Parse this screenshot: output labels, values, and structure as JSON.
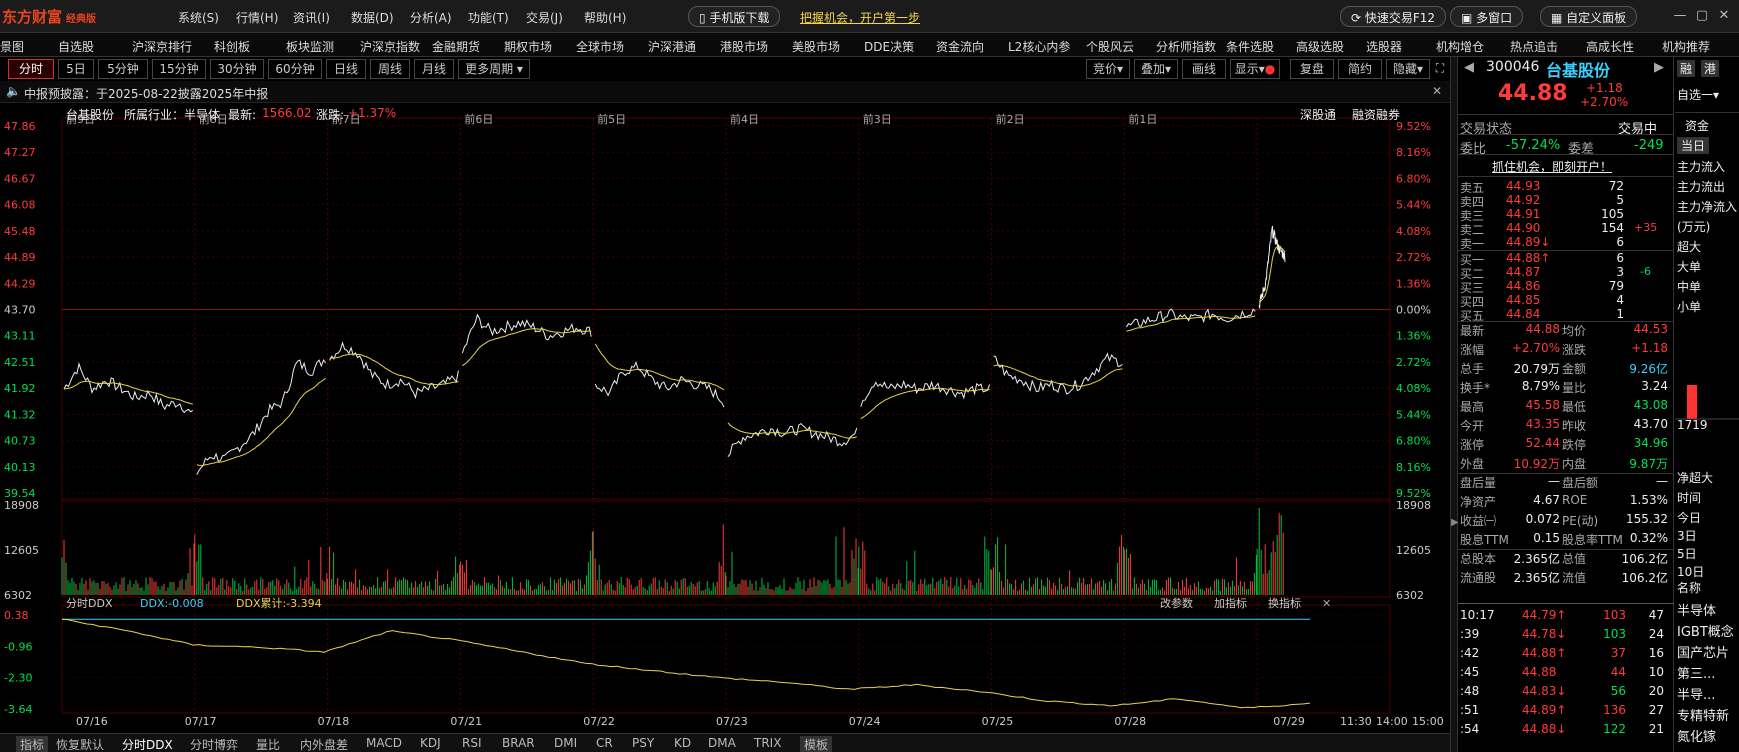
{
  "topbar": {
    "logo": "东方财富",
    "edition": "经典版",
    "menus": [
      "系统(S)",
      "行情(H)",
      "资讯(I)",
      "数据(D)",
      "分析(A)",
      "功能(T)",
      "交易(J)",
      "帮助(H)"
    ],
    "mobile_download": "手机版下载",
    "promo": "把握机会，开户第一步",
    "quick_trade": "快速交易F12",
    "multi_window": "多窗口",
    "custom_panel": "自定义面板"
  },
  "navbar": {
    "items": [
      "景图",
      "自选股",
      "沪深京排行",
      "科创板",
      "板块监测",
      "沪深京指数",
      "金融期货",
      "期权市场",
      "全球市场",
      "沪深港通",
      "港股市场",
      "美股市场",
      "DDE决策",
      "资金流向",
      "L2核心内参",
      "个股风云",
      "分析师指数",
      "条件选股",
      "高级选股",
      "选股器",
      "机构增仓",
      "热点追击",
      "高成长性",
      "机构推荐"
    ]
  },
  "period_tabs": [
    "分时",
    "5日",
    "5分钟",
    "15分钟",
    "30分钟",
    "60分钟",
    "日线",
    "周线",
    "月线",
    "更多周期"
  ],
  "right_tools": [
    "竞价",
    "叠加",
    "画线",
    "显示",
    "复盘",
    "简约",
    "隐藏"
  ],
  "notice": "中报预披露：于2025-08-22披露2025年中报",
  "stock_info": {
    "name": "台基股份",
    "industry_label": "所属行业：半导体",
    "latest_label": "最新:",
    "latest_value": "1566.02",
    "change_label": "涨跌:",
    "change_value": "+1.37%",
    "shen_gu_tong": "深股通",
    "rong_zi": "融资融券"
  },
  "chart_data": {
    "type": "line",
    "title": "",
    "ylim": [
      39.54,
      47.86
    ],
    "price_ticks_left": [
      "47.86",
      "47.27",
      "46.67",
      "46.08",
      "45.48",
      "44.89",
      "44.29",
      "43.70",
      "43.11",
      "42.51",
      "41.92",
      "41.32",
      "40.73",
      "40.13",
      "39.54"
    ],
    "pct_ticks_right": [
      "9.52%",
      "8.16%",
      "6.80%",
      "5.44%",
      "4.08%",
      "2.72%",
      "1.36%",
      "0.00%",
      "1.36%",
      "2.72%",
      "4.08%",
      "5.44%",
      "6.80%",
      "8.16%",
      "9.52%"
    ],
    "day_labels_top": [
      "前9日",
      "前8日",
      "前7日",
      "前6日",
      "前5日",
      "前4日",
      "前3日",
      "前2日",
      "前1日"
    ],
    "date_labels": [
      "07/16",
      "07/17",
      "07/18",
      "07/21",
      "07/22",
      "07/23",
      "07/24",
      "07/25",
      "07/28",
      "07/29"
    ],
    "time_labels": [
      "11:30",
      "14:00",
      "15:00"
    ],
    "prev_close": 43.7,
    "series": [
      {
        "day": "07/16",
        "open": 41.9,
        "points": [
          41.9,
          42.4,
          41.9,
          42.1,
          41.9,
          41.7,
          41.8,
          41.5,
          41.6,
          41.3
        ]
      },
      {
        "day": "07/17",
        "open": 40.2,
        "points": [
          40.0,
          40.4,
          40.3,
          40.6,
          40.9,
          41.4,
          41.6,
          42.5,
          42.3,
          42.6
        ]
      },
      {
        "day": "07/18",
        "open": 42.6,
        "points": [
          42.6,
          42.9,
          42.7,
          42.2,
          42.0,
          42.1,
          41.8,
          41.9,
          42.0,
          42.2
        ]
      },
      {
        "day": "07/21",
        "open": 42.4,
        "points": [
          42.7,
          43.5,
          43.2,
          43.3,
          43.4,
          43.3,
          43.1,
          43.2,
          43.3,
          43.2
        ]
      },
      {
        "day": "07/22",
        "open": 43.0,
        "points": [
          42.0,
          41.8,
          42.3,
          42.4,
          42.1,
          41.9,
          42.1,
          42.0,
          41.9,
          41.6
        ]
      },
      {
        "day": "07/23",
        "open": 41.2,
        "points": [
          40.4,
          40.8,
          40.9,
          41.0,
          40.9,
          41.0,
          40.9,
          40.8,
          40.7,
          40.9
        ]
      },
      {
        "day": "07/24",
        "open": 41.2,
        "points": [
          41.6,
          42.1,
          41.9,
          42.0,
          41.9,
          42.0,
          41.9,
          41.8,
          41.9,
          41.9
        ]
      },
      {
        "day": "07/25",
        "open": 42.4,
        "points": [
          42.6,
          42.2,
          42.1,
          41.9,
          42.0,
          41.9,
          42.0,
          42.3,
          42.6,
          42.5
        ]
      },
      {
        "day": "07/28",
        "open": 43.2,
        "points": [
          43.3,
          43.4,
          43.5,
          43.6,
          43.5,
          43.5,
          43.6,
          43.5,
          43.6,
          43.7
        ]
      },
      {
        "day": "07/29",
        "open": 43.9,
        "points": [
          43.8,
          44.3,
          45.5,
          45.1,
          44.9
        ]
      }
    ],
    "volume_ticks": [
      "18908",
      "12605",
      "6302"
    ],
    "ddx_panel": {
      "label": "分时DDX",
      "ddx": "DDX:-0.008",
      "ddx_sum": "DDX累计:-3.394",
      "ticks": [
        "0.38",
        "-0.96",
        "-2.30",
        "-3.64"
      ],
      "ylim": [
        -3.64,
        0.38
      ],
      "cumulative": [
        0.2,
        -0.3,
        -0.9,
        -1.0,
        -1.2,
        -0.3,
        -0.7,
        -1.2,
        -1.7,
        -2.0,
        -2.3,
        -2.5,
        -2.8,
        -2.6,
        -2.9,
        -3.3,
        -3.5,
        -3.2,
        -3.6,
        -3.4
      ],
      "buttons": [
        "改参数",
        "加指标",
        "换指标"
      ]
    }
  },
  "bottom_tabs": [
    "指标",
    "恢复默认",
    "分时DDX",
    "分时博弈",
    "量比",
    "内外盘差",
    "MACD",
    "KDJ",
    "RSI",
    "BRAR",
    "DMI",
    "CR",
    "PSY",
    "KD",
    "DMA",
    "TRIX",
    "模板"
  ],
  "quote": {
    "code": "300046",
    "name": "台基股份",
    "price": "44.88",
    "change": "+1.18",
    "change_pct": "+2.70%",
    "status_label": "交易状态",
    "status_value": "交易中",
    "weibi_label": "委比",
    "weibi": "-57.24%",
    "weicha_label": "委差",
    "weicha": "-249",
    "promo": "抓住机会，即刻开户！",
    "asks": [
      {
        "label": "卖五",
        "price": "44.93",
        "vol": "72",
        "extra": ""
      },
      {
        "label": "卖四",
        "price": "44.92",
        "vol": "5",
        "extra": ""
      },
      {
        "label": "卖三",
        "price": "44.91",
        "vol": "105",
        "extra": ""
      },
      {
        "label": "卖二",
        "price": "44.90",
        "vol": "154",
        "extra": "+35"
      },
      {
        "label": "卖一",
        "price": "44.89",
        "vol": "6",
        "extra": ""
      }
    ],
    "bids": [
      {
        "label": "买一",
        "price": "44.88",
        "vol": "6",
        "extra": ""
      },
      {
        "label": "买二",
        "price": "44.87",
        "vol": "3",
        "extra": "-6"
      },
      {
        "label": "买三",
        "price": "44.86",
        "vol": "79",
        "extra": ""
      },
      {
        "label": "买四",
        "price": "44.85",
        "vol": "4",
        "extra": ""
      },
      {
        "label": "买五",
        "price": "44.84",
        "vol": "1",
        "extra": ""
      }
    ],
    "stats": [
      {
        "k1": "最新",
        "v1": "44.88",
        "k2": "均价",
        "v2": "44.53"
      },
      {
        "k1": "涨幅",
        "v1": "+2.70%",
        "k2": "涨跌",
        "v2": "+1.18"
      },
      {
        "k1": "总手",
        "v1": "20.79万",
        "k2": "金额",
        "v2": "9.26亿"
      },
      {
        "k1": "换手*",
        "v1": "8.79%",
        "k2": "量比",
        "v2": "3.24"
      },
      {
        "k1": "最高",
        "v1": "45.58",
        "k2": "最低",
        "v2": "43.08"
      },
      {
        "k1": "今开",
        "v1": "43.35",
        "k2": "昨收",
        "v2": "43.70"
      },
      {
        "k1": "涨停",
        "v1": "52.44",
        "k2": "跌停",
        "v2": "34.96"
      },
      {
        "k1": "外盘",
        "v1": "10.92万",
        "k2": "内盘",
        "v2": "9.87万"
      },
      {
        "k1": "盘后量",
        "v1": "—",
        "k2": "盘后额",
        "v2": "—"
      },
      {
        "k1": "净资产",
        "v1": "4.67",
        "k2": "ROE",
        "v2": "1.53%"
      },
      {
        "k1": "收益㈠",
        "v1": "0.072",
        "k2": "PE(动)",
        "v2": "155.32"
      },
      {
        "k1": "股息TTM",
        "v1": "0.15",
        "k2": "股息率TTM",
        "v2": "0.32%"
      },
      {
        "k1": "总股本",
        "v1": "2.365亿",
        "k2": "总值",
        "v2": "106.2亿"
      },
      {
        "k1": "流通股",
        "v1": "2.365亿",
        "k2": "流值",
        "v2": "106.2亿"
      }
    ],
    "ticks": [
      {
        "time": "10:17",
        "price": "44.79",
        "vol": "103",
        "n": "47",
        "dir": "up"
      },
      {
        "time": ":39",
        "price": "44.78",
        "vol": "103",
        "n": "24",
        "dir": "down"
      },
      {
        "time": ":42",
        "price": "44.88",
        "vol": "37",
        "n": "16",
        "dir": "up"
      },
      {
        "time": ":45",
        "price": "44.88",
        "vol": "44",
        "n": "10",
        "dir": ""
      },
      {
        "time": ":48",
        "price": "44.83",
        "vol": "56",
        "n": "20",
        "dir": "down"
      },
      {
        "time": ":51",
        "price": "44.89",
        "vol": "136",
        "n": "27",
        "dir": "up"
      },
      {
        "time": ":54",
        "price": "44.88",
        "vol": "122",
        "n": "21",
        "dir": "down"
      }
    ]
  },
  "side": {
    "btn_rong": "融",
    "btn_ji": "港",
    "watch": "自选",
    "tab_zijin": "资金",
    "tab_today": "当日",
    "flows": [
      "主力流入",
      "主力流出",
      "主力净流入",
      "(万元)",
      "超大",
      "大单",
      "中单",
      "小单"
    ],
    "bar_value": "1719",
    "net_label": "净超大",
    "time_label": "时间",
    "periods": [
      "今日",
      "3日",
      "5日",
      "10日"
    ],
    "name_label": "名称",
    "sectors": [
      "半导体",
      "IGBT概念",
      "国产芯片",
      "第三...",
      "半导...",
      "专精特新",
      "氮化镓"
    ]
  }
}
